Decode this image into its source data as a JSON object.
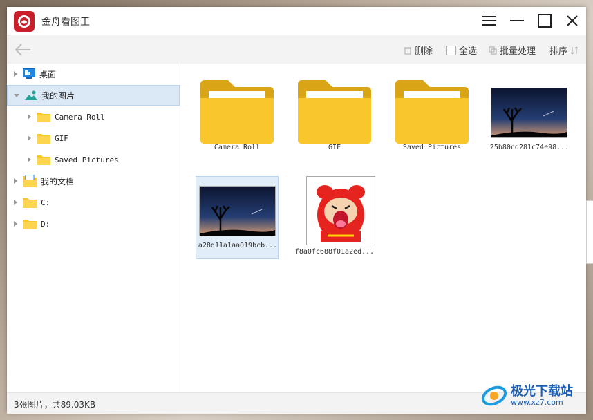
{
  "app": {
    "title": "金舟看图王"
  },
  "window_controls": {
    "menu": "menu-icon",
    "minimize": "minimize-icon",
    "maximize": "maximize-icon",
    "close": "close-icon"
  },
  "toolbar": {
    "back": "back-arrow-icon",
    "delete_label": "删除",
    "select_all_label": "全选",
    "batch_label": "批量处理",
    "sort_label": "排序"
  },
  "sidebar": {
    "items": [
      {
        "label": "桌面",
        "icon": "desktop-icon",
        "expanded": false
      },
      {
        "label": "我的图片",
        "icon": "pictures-icon",
        "expanded": true,
        "selected": true
      },
      {
        "label": "Camera Roll",
        "icon": "folder-icon",
        "child": true
      },
      {
        "label": "GIF",
        "icon": "folder-icon",
        "child": true
      },
      {
        "label": "Saved Pictures",
        "icon": "folder-icon",
        "child": true
      },
      {
        "label": "我的文档",
        "icon": "documents-icon"
      },
      {
        "label": "C:",
        "icon": "folder-icon"
      },
      {
        "label": "D:",
        "icon": "folder-icon"
      }
    ]
  },
  "content": {
    "tiles": [
      {
        "label": "Camera Roll",
        "type": "folder"
      },
      {
        "label": "GIF",
        "type": "folder"
      },
      {
        "label": "Saved Pictures",
        "type": "folder"
      },
      {
        "label": "25b80cd281c74e98...",
        "type": "image-night"
      },
      {
        "label": "a28d11a1aa019bcb...",
        "type": "image-night",
        "selected": true
      },
      {
        "label": "f8a0fc688f01a2ed...",
        "type": "image-cartoon"
      }
    ]
  },
  "status": {
    "text": "3张图片，共89.03KB"
  },
  "watermark": {
    "text": "极光下载站",
    "url": "www.xz7.com"
  },
  "colors": {
    "folder": "#f9c62b",
    "folder_dark": "#d9a416",
    "selection": "#dbe9f7",
    "brand": "#c8202a"
  }
}
